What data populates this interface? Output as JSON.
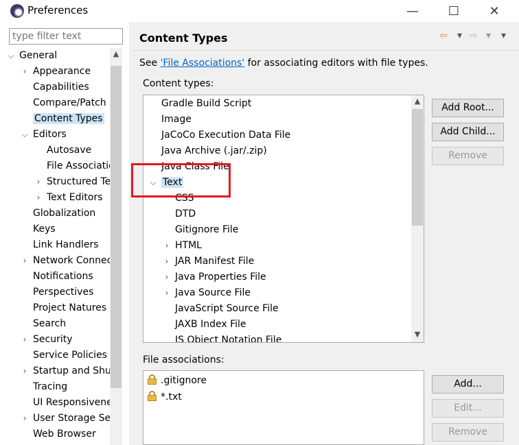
{
  "window": {
    "title": "Preferences",
    "minimize": "—",
    "maximize": "☐",
    "close": "✕"
  },
  "filter": {
    "placeholder": "type filter text"
  },
  "left_tree": [
    {
      "label": "General",
      "chevron": "⌵",
      "depth": 0
    },
    {
      "label": "Appearance",
      "chevron": "›",
      "depth": 1
    },
    {
      "label": "Capabilities",
      "chevron": "",
      "depth": 1
    },
    {
      "label": "Compare/Patch",
      "chevron": "",
      "depth": 1
    },
    {
      "label": "Content Types",
      "chevron": "",
      "depth": 1,
      "selected": true
    },
    {
      "label": "Editors",
      "chevron": "⌵",
      "depth": 1
    },
    {
      "label": "Autosave",
      "chevron": "",
      "depth": 2
    },
    {
      "label": "File Associations",
      "chevron": "",
      "depth": 2
    },
    {
      "label": "Structured Text",
      "chevron": "›",
      "depth": 2
    },
    {
      "label": "Text Editors",
      "chevron": "›",
      "depth": 2
    },
    {
      "label": "Globalization",
      "chevron": "",
      "depth": 1
    },
    {
      "label": "Keys",
      "chevron": "",
      "depth": 1
    },
    {
      "label": "Link Handlers",
      "chevron": "",
      "depth": 1
    },
    {
      "label": "Network Connections",
      "chevron": "›",
      "depth": 1
    },
    {
      "label": "Notifications",
      "chevron": "",
      "depth": 1
    },
    {
      "label": "Perspectives",
      "chevron": "",
      "depth": 1
    },
    {
      "label": "Project Natures",
      "chevron": "",
      "depth": 1
    },
    {
      "label": "Search",
      "chevron": "",
      "depth": 1
    },
    {
      "label": "Security",
      "chevron": "›",
      "depth": 1
    },
    {
      "label": "Service Policies",
      "chevron": "",
      "depth": 1
    },
    {
      "label": "Startup and Shutdown",
      "chevron": "›",
      "depth": 1
    },
    {
      "label": "Tracing",
      "chevron": "",
      "depth": 1
    },
    {
      "label": "UI Responsiveness",
      "chevron": "",
      "depth": 1
    },
    {
      "label": "User Storage Service",
      "chevron": "›",
      "depth": 1
    },
    {
      "label": "Web Browser",
      "chevron": "",
      "depth": 1
    }
  ],
  "page": {
    "title": "Content Types",
    "nav_back": "⇦",
    "nav_back_menu": "▾",
    "nav_forward": "⇨",
    "nav_forward_menu": "▾",
    "view_menu": "▾",
    "see_prefix": "See ",
    "see_link": "'File Associations'",
    "see_suffix": " for associating editors with file types.",
    "content_types_label": "Content types:",
    "file_assoc_label": "File associations:"
  },
  "content_types": [
    {
      "label": "Gradle Build Script",
      "chevron": "",
      "depth": 0
    },
    {
      "label": "Image",
      "chevron": "",
      "depth": 0
    },
    {
      "label": "JaCoCo Execution Data File",
      "chevron": "",
      "depth": 0
    },
    {
      "label": "Java Archive (.jar/.zip)",
      "chevron": "",
      "depth": 0
    },
    {
      "label": "Java Class File",
      "chevron": "",
      "depth": 0
    },
    {
      "label": "Text",
      "chevron": "⌵",
      "depth": 0,
      "selected": true
    },
    {
      "label": "CSS",
      "chevron": "",
      "depth": 1
    },
    {
      "label": "DTD",
      "chevron": "",
      "depth": 1
    },
    {
      "label": "Gitignore File",
      "chevron": "",
      "depth": 1
    },
    {
      "label": "HTML",
      "chevron": "›",
      "depth": 1
    },
    {
      "label": "JAR Manifest File",
      "chevron": "›",
      "depth": 1
    },
    {
      "label": "Java Properties File",
      "chevron": "›",
      "depth": 1
    },
    {
      "label": "Java Source File",
      "chevron": "›",
      "depth": 1
    },
    {
      "label": "JavaScript Source File",
      "chevron": "",
      "depth": 1
    },
    {
      "label": "JAXB Index File",
      "chevron": "",
      "depth": 1
    },
    {
      "label": "JS Object Notation File",
      "chevron": "",
      "depth": 1
    }
  ],
  "content_type_buttons": {
    "add_root": "Add Root...",
    "add_child": "Add Child...",
    "remove": "Remove"
  },
  "file_associations": [
    {
      "label": ".gitignore",
      "locked": true
    },
    {
      "label": "*.txt",
      "locked": true
    }
  ],
  "file_assoc_buttons": {
    "add": "Add...",
    "edit": "Edit...",
    "remove": "Remove"
  },
  "scroll_arrows": {
    "up": "▲",
    "down": "▼"
  }
}
